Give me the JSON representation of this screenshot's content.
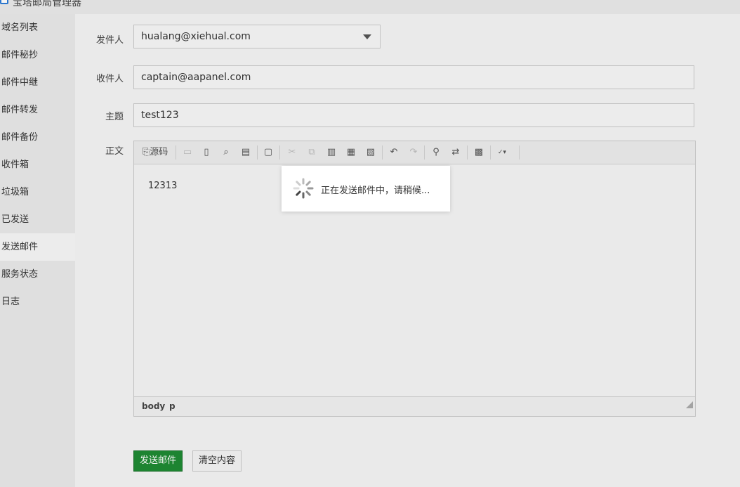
{
  "window": {
    "title": "宝塔邮局管理器"
  },
  "sidebar": {
    "items": [
      {
        "label": "域名列表"
      },
      {
        "label": "邮件秘抄"
      },
      {
        "label": "邮件中继"
      },
      {
        "label": "邮件转发"
      },
      {
        "label": "邮件备份"
      },
      {
        "label": "收件箱"
      },
      {
        "label": "垃圾箱"
      },
      {
        "label": "已发送"
      },
      {
        "label": "发送邮件",
        "active": true
      },
      {
        "label": "服务状态"
      },
      {
        "label": "日志"
      }
    ]
  },
  "form": {
    "sender_label": "发件人",
    "sender_value": "hualang@xiehual.com",
    "recipient_label": "收件人",
    "recipient_value": "captain@aapanel.com",
    "subject_label": "主题",
    "subject_value": "test123",
    "body_label": "正文"
  },
  "editor": {
    "source_label": "源码",
    "content": "12313",
    "status_path": [
      "body",
      "p"
    ],
    "toolbar_icons": [
      "source-icon",
      "save-icon",
      "new-page-icon",
      "preview-icon",
      "print-icon",
      "templates-icon",
      "cut-icon",
      "copy-icon",
      "paste-icon",
      "paste-text-icon",
      "paste-word-icon",
      "undo-icon",
      "redo-icon",
      "find-icon",
      "replace-icon",
      "select-all-icon",
      "spellcheck-icon"
    ]
  },
  "buttons": {
    "send": "发送邮件",
    "clear": "清空内容"
  },
  "loading": {
    "message": "正在发送邮件中，请稍候..."
  },
  "colors": {
    "primary_button": "#1f8a33",
    "sidebar_bg": "#e9e9e9",
    "active_item_bg": "#f6f6f6"
  }
}
